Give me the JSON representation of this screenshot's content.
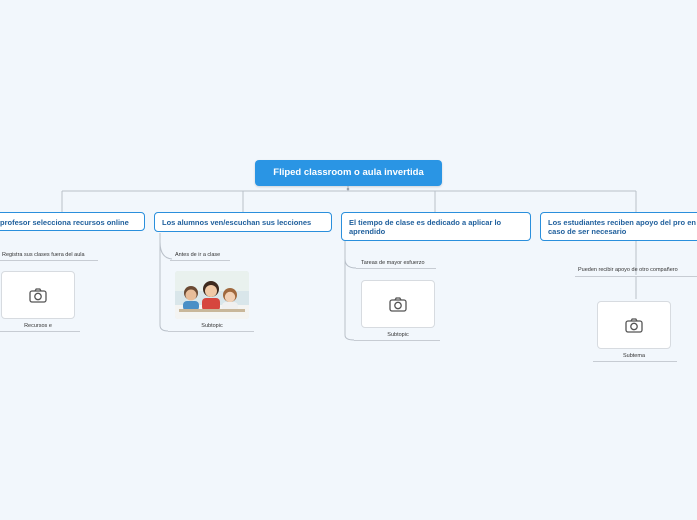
{
  "root": {
    "title": "Fliped classroom o aula invertida"
  },
  "branches": [
    {
      "title": "profesor selecciona recursos online",
      "subtopic": "Registra sus clases fuera del aula",
      "card_caption": "Recursos e"
    },
    {
      "title": "Los alumnos ven/escuchan sus lecciones",
      "subtopic": "Antes de ir a clase",
      "card_caption": "Subtopic"
    },
    {
      "title": "El tiempo de clase es dedicado a aplicar lo aprendido",
      "subtopic": "Tareas de mayor esfuerzo",
      "card_caption": "Subtopic"
    },
    {
      "title": "Los estudiantes reciben apoyo del pro en caso de ser necesario",
      "subtopic": "Pueden recibir apoyo de otro compañero",
      "card_caption": "Subtema"
    }
  ],
  "colors": {
    "background": "#f2f7fc",
    "accent": "#2a95e4",
    "line": "#c7ccd3"
  },
  "icons": [
    "camera-icon"
  ]
}
